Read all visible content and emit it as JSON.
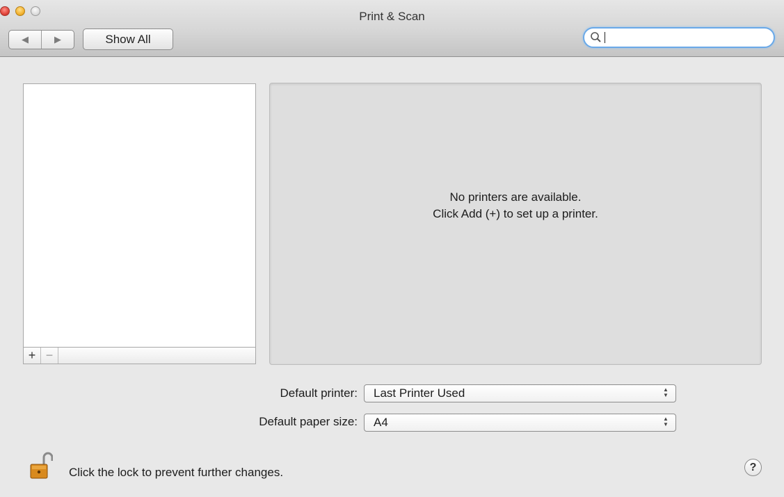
{
  "window": {
    "title": "Print & Scan"
  },
  "toolbar": {
    "back_glyph": "◀",
    "forward_glyph": "▶",
    "show_all_label": "Show All",
    "search_value": ""
  },
  "printer_list": {
    "add_label": "+",
    "remove_label": "−"
  },
  "detail": {
    "line1": "No printers are available.",
    "line2": "Click Add (+) to set up a printer."
  },
  "defaults": {
    "printer_label": "Default printer:",
    "printer_value": "Last Printer Used",
    "paper_label": "Default paper size:",
    "paper_value": "A4"
  },
  "footer": {
    "lock_text": "Click the lock to prevent further changes.",
    "help_label": "?"
  },
  "icons": {
    "close": "close-icon",
    "minimize": "minimize-icon",
    "zoom": "zoom-icon",
    "search": "search-icon",
    "lock": "open-lock-icon",
    "help": "help-icon"
  },
  "colors": {
    "focus_ring": "#6aa9e8",
    "close": "#e0443a",
    "minimize": "#f3b230"
  }
}
